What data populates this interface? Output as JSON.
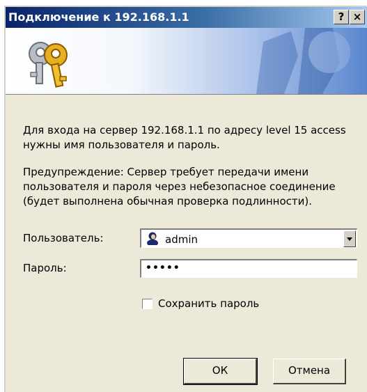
{
  "window": {
    "title": "Подключение к 192.168.1.1",
    "help_label": "?",
    "close_label": "×"
  },
  "banner": {
    "icon": "keys-icon"
  },
  "message": {
    "intro": "Для входа на сервер 192.168.1.1 по адресу level 15 access нужны имя пользователя и пароль.",
    "warning": "Предупреждение: Сервер требует передачи имени пользователя и пароля через небезопасное соединение (будет выполнена обычная проверка подлинности)."
  },
  "form": {
    "username_label": "Пользователь:",
    "username_value": "admin",
    "password_label": "Пароль:",
    "password_value": "•••••",
    "remember_label": "Сохранить пароль",
    "remember_checked": false
  },
  "buttons": {
    "ok": "ОК",
    "cancel": "Отмена"
  }
}
